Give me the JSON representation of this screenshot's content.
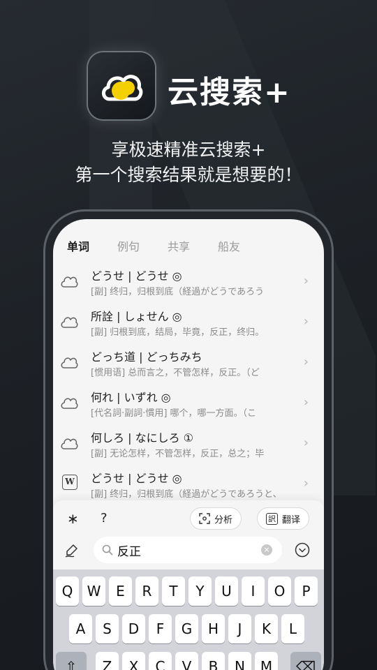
{
  "app": {
    "title": "云搜索+",
    "tagline_1": "享极速精准云搜索+",
    "tagline_2": "第一个搜索结果就是想要的！"
  },
  "tabs": [
    {
      "label": "单词",
      "active": true
    },
    {
      "label": "例句",
      "active": false
    },
    {
      "label": "共享",
      "active": false
    },
    {
      "label": "船友",
      "active": false
    }
  ],
  "results": [
    {
      "icon": "cloud-icon",
      "term": "どうせ | どうせ ◎",
      "def": "[副] 终归，归根到底（経過がどうであろう"
    },
    {
      "icon": "cloud-icon",
      "term": "所詮 | しょせん ◎",
      "def": "[副] 归根到底，结局，毕竟，反正，终归。"
    },
    {
      "icon": "cloud-icon",
      "term": "どっち道 | どっちみち",
      "def": "[惯用语] 总而言之，不管怎样，反正。（ど"
    },
    {
      "icon": "cloud-icon",
      "term": "何れ | いずれ ◎",
      "def": "[代名詞·副詞·慣用] 哪个，哪一方面。（こ"
    },
    {
      "icon": "cloud-icon",
      "term": "何しろ | なにしろ ①",
      "def": "[副] 无论怎样，不管怎样，反正，总之；毕"
    },
    {
      "icon": "dictionary-icon",
      "icon_text": "W",
      "term": "どうせ | どうせ ◎",
      "def": "[副] 终归，归根到底（経過がどうであろうと、"
    }
  ],
  "toolbar": {
    "asterisk": "∗",
    "question": "?",
    "analyze_label": "分析",
    "translate_label": "翻译",
    "translate_icon_text": "訳"
  },
  "search": {
    "value": "反正",
    "clear": "×"
  },
  "keyboard": {
    "row1": [
      "Q",
      "W",
      "E",
      "R",
      "T",
      "Y",
      "U",
      "I",
      "O",
      "P"
    ],
    "row2": [
      "A",
      "S",
      "D",
      "F",
      "G",
      "H",
      "J",
      "K",
      "L"
    ],
    "row3": [
      "Z",
      "X",
      "C",
      "V",
      "B",
      "N",
      "M"
    ],
    "shift": "⇧",
    "backspace": "⌫"
  },
  "colors": {
    "accent_yellow": "#f5d000",
    "caret": "#e53935"
  }
}
